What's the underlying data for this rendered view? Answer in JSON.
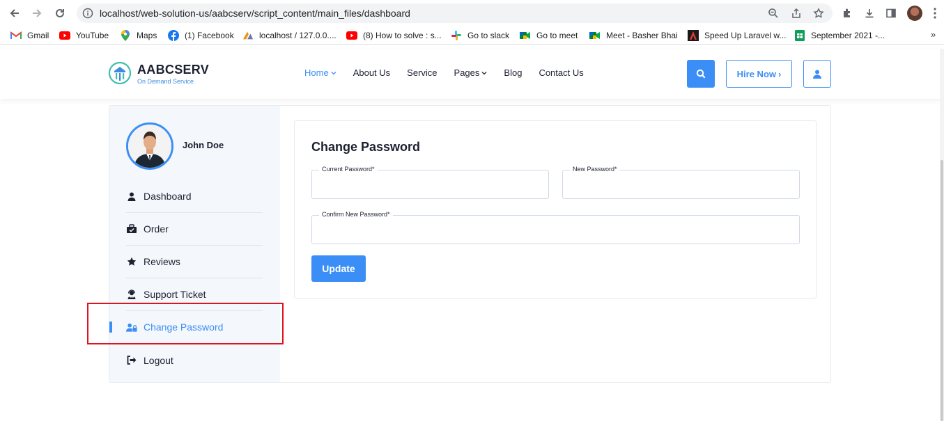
{
  "browser": {
    "url": "localhost/web-solution-us/aabcserv/script_content/main_files/dashboard",
    "bookmarks": [
      {
        "label": "Gmail",
        "icon": "gmail-icon"
      },
      {
        "label": "YouTube",
        "icon": "youtube-icon"
      },
      {
        "label": "Maps",
        "icon": "maps-icon"
      },
      {
        "label": "(1) Facebook",
        "icon": "facebook-icon"
      },
      {
        "label": "localhost / 127.0.0....",
        "icon": "phpmyadmin-icon"
      },
      {
        "label": "(8) How to solve : s...",
        "icon": "youtube-icon"
      },
      {
        "label": "Go to slack",
        "icon": "slack-icon"
      },
      {
        "label": "Go to meet",
        "icon": "meet-icon"
      },
      {
        "label": "Meet - Basher Bhai",
        "icon": "meet-icon"
      },
      {
        "label": "Speed Up Laravel w...",
        "icon": "laravel-icon"
      },
      {
        "label": "September 2021 -...",
        "icon": "sheets-icon"
      }
    ],
    "more": "»"
  },
  "header": {
    "brand": "AABCSERV",
    "tagline": "On Demand Service",
    "menu": [
      {
        "label": "Home",
        "dropdown": true,
        "active": true
      },
      {
        "label": "About Us",
        "dropdown": false
      },
      {
        "label": "Service",
        "dropdown": false
      },
      {
        "label": "Pages",
        "dropdown": true
      },
      {
        "label": "Blog",
        "dropdown": false
      },
      {
        "label": "Contact Us",
        "dropdown": false
      }
    ],
    "hire_label": "Hire Now",
    "hire_arrow": "›",
    "accent": "#3a8ef6"
  },
  "sidebar": {
    "username": "John Doe",
    "items": [
      {
        "label": "Dashboard",
        "icon": "user-icon"
      },
      {
        "label": "Order",
        "icon": "order-icon"
      },
      {
        "label": "Reviews",
        "icon": "star-icon"
      },
      {
        "label": "Support Ticket",
        "icon": "support-icon"
      },
      {
        "label": "Change Password",
        "icon": "user-lock-icon",
        "active": true
      },
      {
        "label": "Logout",
        "icon": "logout-icon"
      }
    ]
  },
  "form": {
    "title": "Change Password",
    "current_password_label": "Current Password*",
    "new_password_label": "New Password*",
    "confirm_password_label": "Confirm New Password*",
    "current_password_value": "",
    "new_password_value": "",
    "confirm_password_value": "",
    "submit_label": "Update"
  }
}
